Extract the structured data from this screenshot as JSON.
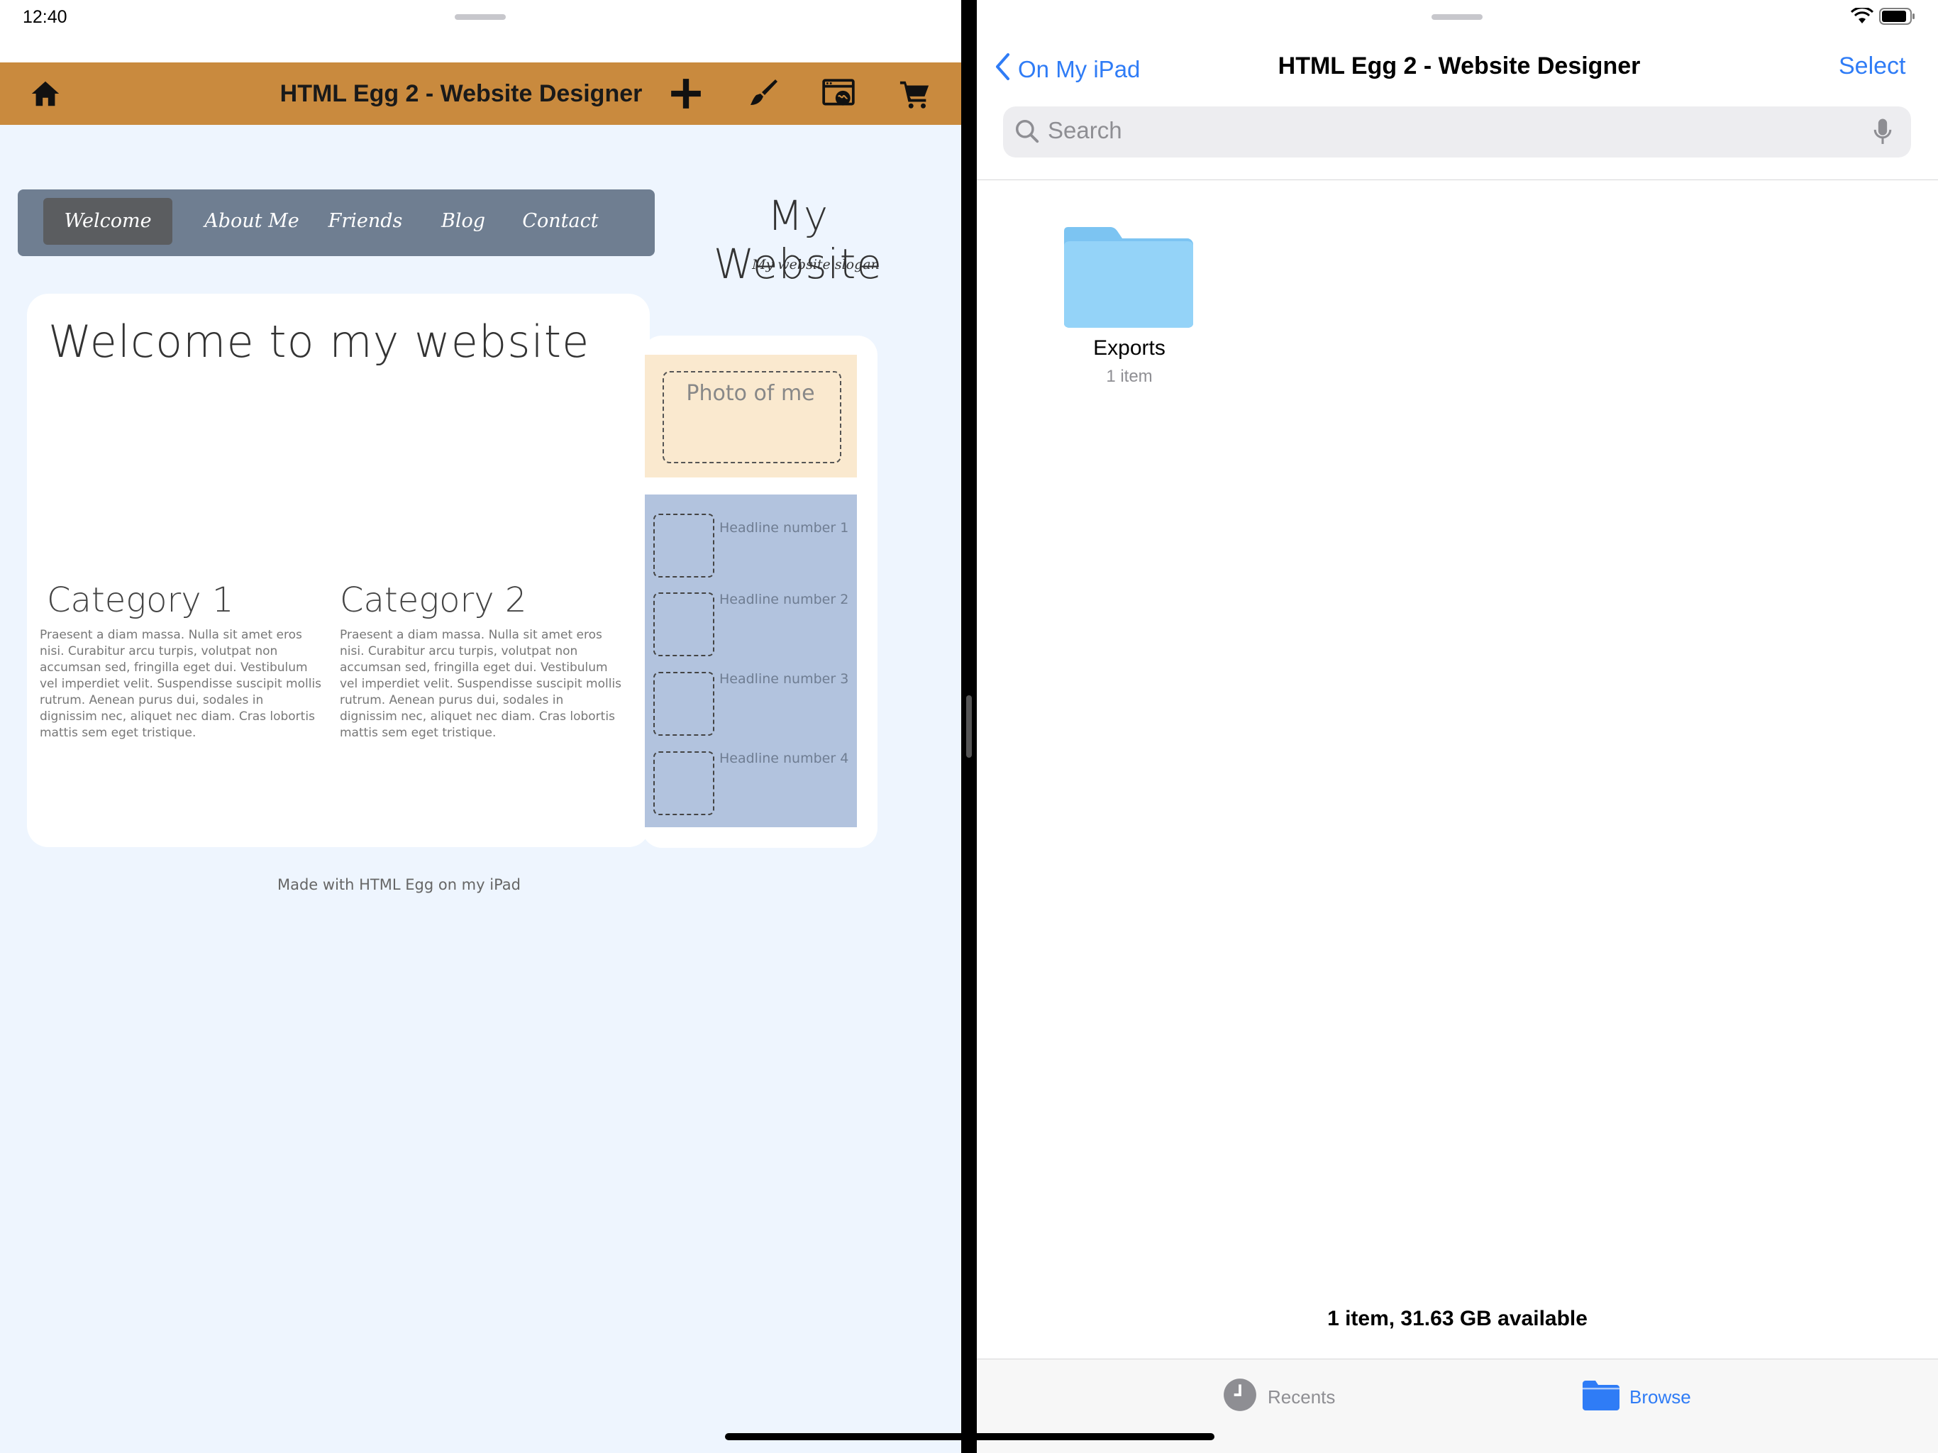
{
  "status_bar": {
    "time": "12:40"
  },
  "left_app": {
    "title": "HTML Egg 2 - Website Designer",
    "toolbar_icons": [
      "home-icon",
      "plus-icon",
      "brush-icon",
      "browser-globe-icon",
      "cart-icon"
    ],
    "accent_color": "#c98a3e",
    "preview": {
      "nav_items": [
        "Welcome",
        "About Me",
        "Friends",
        "Blog",
        "Contact"
      ],
      "active_nav": "Welcome",
      "site_title": "My Website",
      "slogan": "My website slogan",
      "welcome_heading": "Welcome to my website",
      "categories": [
        {
          "title": "Category 1",
          "text": "Praesent a diam massa. Nulla sit amet eros nisi. Curabitur arcu turpis, volutpat non accumsan sed, fringilla eget dui. Vestibulum vel imperdiet velit. Suspendisse suscipit mollis rutrum. Aenean purus dui, sodales in dignissim nec, aliquet nec diam. Cras lobortis mattis sem eget tristique."
        },
        {
          "title": "Category 2",
          "text": "Praesent a diam massa. Nulla sit amet eros nisi. Curabitur arcu turpis, volutpat non accumsan sed, fringilla eget dui. Vestibulum vel imperdiet velit. Suspendisse suscipit mollis rutrum. Aenean purus dui, sodales in dignissim nec, aliquet nec diam. Cras lobortis mattis sem eget tristique."
        }
      ],
      "photo_label": "Photo of me",
      "headlines": [
        "Headline number 1",
        "Headline number 2",
        "Headline number 3",
        "Headline number 4"
      ],
      "footer": "Made with HTML Egg on my iPad"
    }
  },
  "right_app": {
    "back_label": "On My iPad",
    "title": "HTML Egg 2 - Website Designer",
    "select_label": "Select",
    "search_placeholder": "Search",
    "folder": {
      "name": "Exports",
      "count": "1 item",
      "color": "#8fd0f6"
    },
    "storage_info": "1 item, 31.63 GB available",
    "tabs": [
      {
        "label": "Recents",
        "icon": "clock-icon",
        "active": false
      },
      {
        "label": "Browse",
        "icon": "folder-icon",
        "active": true
      }
    ],
    "accent_color": "#2f7cf6"
  }
}
